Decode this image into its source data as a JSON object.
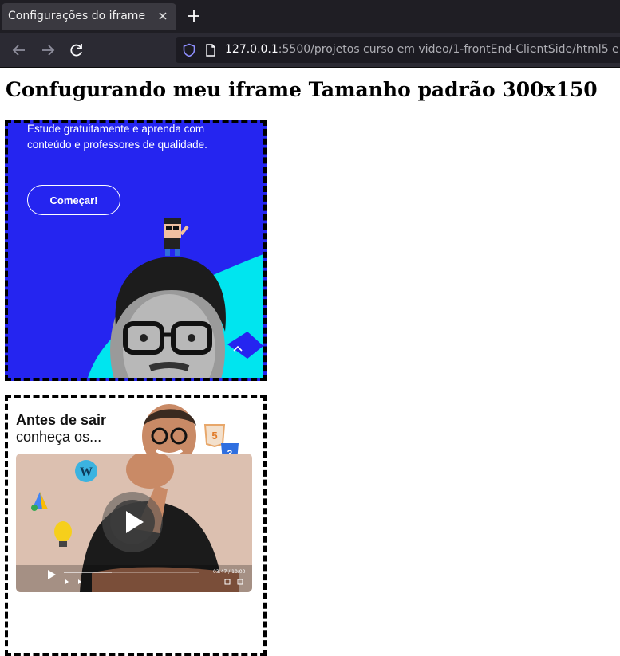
{
  "browser": {
    "tab_title": "Configurações do iframe",
    "url_host": "127.0.0.1",
    "url_rest": ":5500/projetos curso em video/1-frontEnd-ClientSide/html5 e"
  },
  "page": {
    "heading": "Confugurando meu iframe Tamanho padrão 300x150"
  },
  "iframe1": {
    "hero_text": "Estude gratuitamente e aprenda com conteúdo e professores de qualidade.",
    "start_button": "Começar!"
  },
  "iframe2": {
    "title": "Antes de sair",
    "subtitle": "conheça os...",
    "video_time": "03:47 / 10:00"
  },
  "colors": {
    "hero_bg": "#2525f0",
    "hero_accent": "#00e5ef",
    "chrome_bg": "#2b2a33"
  }
}
